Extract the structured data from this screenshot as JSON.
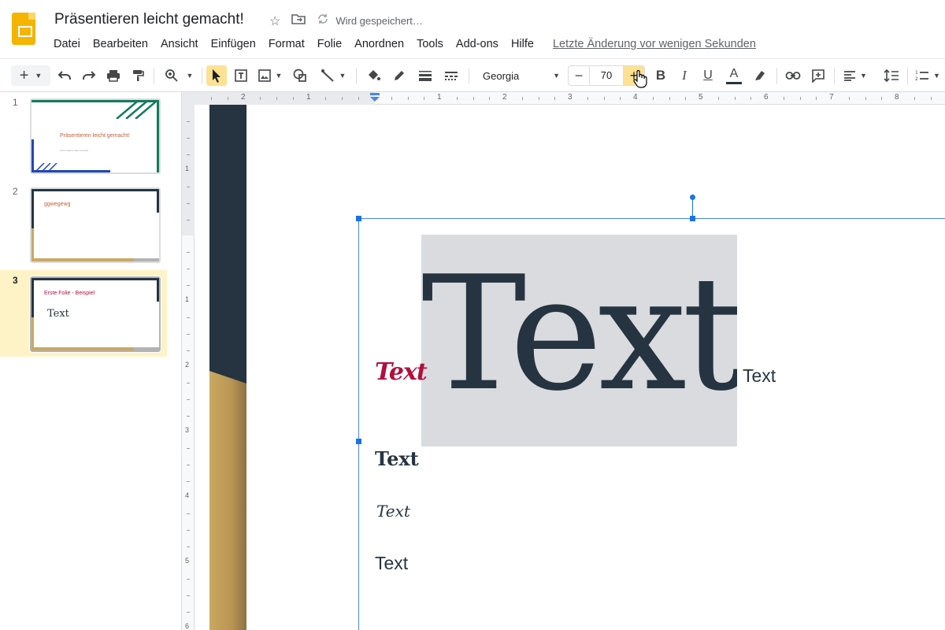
{
  "header": {
    "title": "Präsentieren leicht gemacht!",
    "saving_status": "Wird gespeichert…",
    "menu": [
      "Datei",
      "Bearbeiten",
      "Ansicht",
      "Einfügen",
      "Format",
      "Folie",
      "Anordnen",
      "Tools",
      "Add-ons",
      "Hilfe"
    ],
    "last_edit": "Letzte Änderung vor wenigen Sekunden"
  },
  "toolbar": {
    "font_name": "Georgia",
    "font_size": "70",
    "minus": "−",
    "plus": "+"
  },
  "slides": [
    {
      "number": "1",
      "title": "Präsentieren leicht gemacht!",
      "subtitle": "Lorem ipsum dolor sit amet"
    },
    {
      "number": "2",
      "title": "ggwegewg"
    },
    {
      "number": "3",
      "title": "Erste Folie - Beispiel",
      "body": "Text"
    }
  ],
  "rulers": {
    "horizontal": [
      "2",
      "1",
      "1",
      "2",
      "3",
      "4",
      "5",
      "6",
      "7",
      "8"
    ],
    "vertical": [
      "1",
      "1",
      "2",
      "3",
      "4",
      "5",
      "6"
    ]
  },
  "canvas": {
    "big_text": "Text",
    "red_text": "Text",
    "after_text": "Text",
    "bold_text": "Text",
    "script_text": "Text",
    "plain_text": "Text"
  },
  "colors": {
    "accent": "#f4b400",
    "selection": "#1a73e8",
    "dark": "#263441",
    "gold": "#c9a862",
    "red": "#b0103c"
  }
}
